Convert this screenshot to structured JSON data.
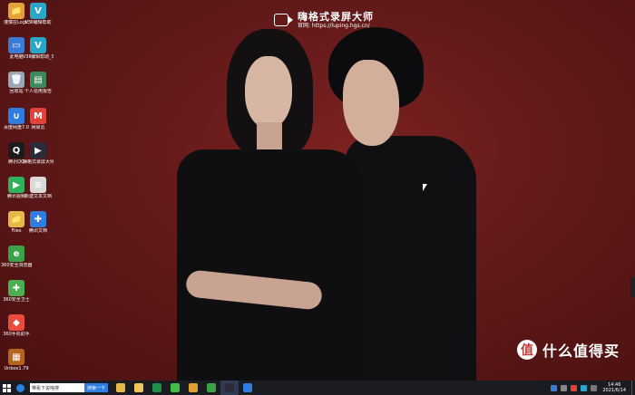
{
  "watermark": {
    "title": "嗨格式录屏大师",
    "url": "官网: https://luping.hgs.cn/"
  },
  "desktop_icons": [
    {
      "label": "谨慎在Logic",
      "color": "#e5a23a",
      "glyph": "📁"
    },
    {
      "label": "V3Ⅱ编辑帮助",
      "color": "#2aa6c8",
      "glyph": "V"
    },
    {
      "label": "此电脑",
      "color": "#3a7bd5",
      "glyph": "▭"
    },
    {
      "label": "V3Ⅱ编辑帮助_Setup_3.0",
      "color": "#2aa6c8",
      "glyph": "V"
    },
    {
      "label": "回收站",
      "color": "#9aa8b6",
      "glyph": "🗑"
    },
    {
      "label": "个人信用报告",
      "color": "#3d8a5a",
      "glyph": "▤"
    },
    {
      "label": "百度网盘7.0",
      "color": "#2f7de0",
      "glyph": "∪"
    },
    {
      "label": "网易云",
      "color": "#e0433a",
      "glyph": "M"
    },
    {
      "label": "腾讯QQ",
      "color": "#1b1b1b",
      "glyph": "Q"
    },
    {
      "label": "嗨格式录屏大师",
      "color": "#2b2b3a",
      "glyph": "▶"
    },
    {
      "label": "腾讯视频",
      "color": "#2fb25a",
      "glyph": "▶"
    },
    {
      "label": "新建文本文档",
      "color": "#d9d9d9",
      "glyph": "≡"
    },
    {
      "label": "Files",
      "color": "#e5b84a",
      "glyph": "📁"
    },
    {
      "label": "腾讯文档",
      "color": "#2f7de0",
      "glyph": "✚"
    },
    {
      "label": "360安全浏览器",
      "color": "#3aa34a",
      "glyph": "e"
    },
    {
      "label": "360安全卫士",
      "color": "#4caf50",
      "glyph": "✚"
    },
    {
      "label": "360手机助手",
      "color": "#e84c3d",
      "glyph": "◆"
    },
    {
      "label": "Unbox1.79",
      "color": "#b5651d",
      "glyph": "▦"
    }
  ],
  "taskbar": {
    "search_placeholder": "带看下说啥搜",
    "search_button": "搜索一下",
    "apps": [
      {
        "name": "explorer",
        "color": "#e5b84a"
      },
      {
        "name": "folder",
        "color": "#f0c65a"
      },
      {
        "name": "excel",
        "color": "#1f8f4a"
      },
      {
        "name": "wechat",
        "color": "#3fbf4a"
      },
      {
        "name": "chrome",
        "color": "#e0a030"
      },
      {
        "name": "360-browser",
        "color": "#3aa34a"
      },
      {
        "name": "screen-recorder",
        "color": "#2b2b3a"
      },
      {
        "name": "tencent-docs",
        "color": "#2f7de0"
      }
    ],
    "clock_time": "14:46",
    "clock_date": "2021/6/14"
  },
  "badge": {
    "icon": "值",
    "text": "什么值得买"
  }
}
